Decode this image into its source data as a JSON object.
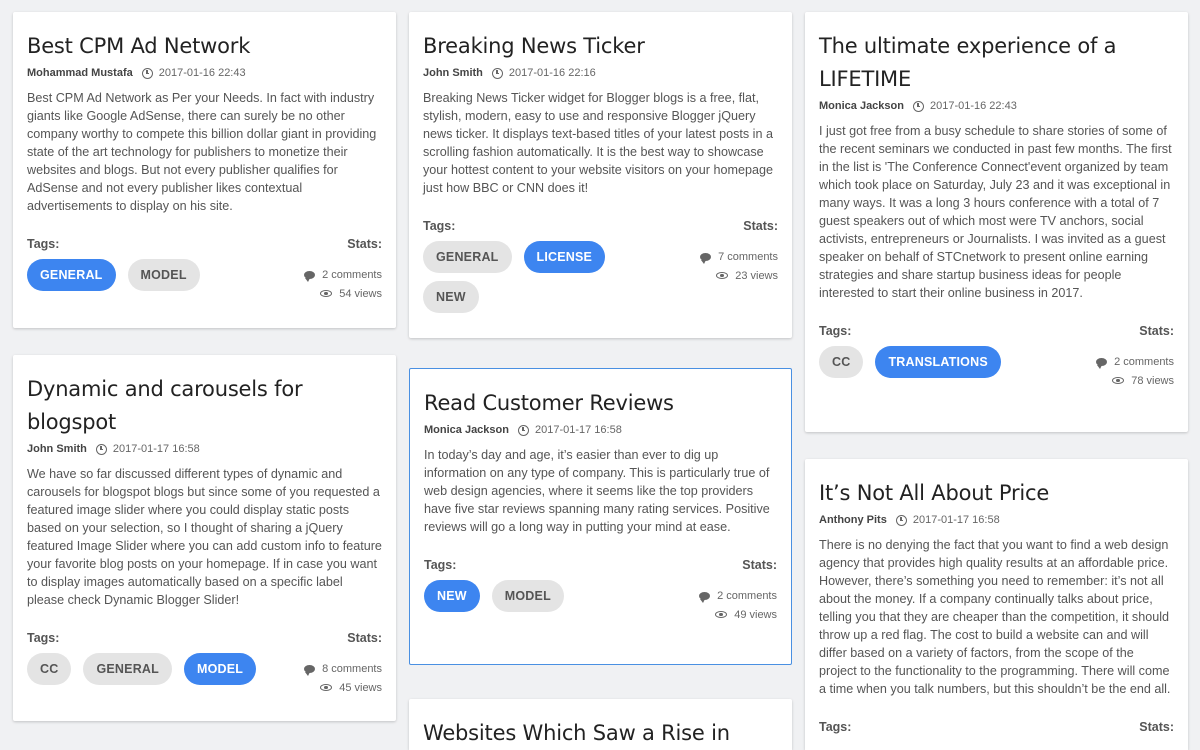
{
  "labels": {
    "tags": "Tags:",
    "stats": "Stats:"
  },
  "colors": {
    "accent": "#3d85f0",
    "page_bg": "#f0f1f3",
    "active_border": "#4a90e2"
  },
  "icons": {
    "clock": "clock-icon",
    "comment": "comment-icon",
    "views": "eye-icon"
  },
  "posts": [
    {
      "title": "Best CPM Ad Network",
      "author": "Mohammad Mustafa",
      "date": "2017-01-16 22:43",
      "excerpt": "Best CPM Ad Network as Per your Needs. In fact with industry giants like Google AdSense, there can surely be no other company worthy to compete this billion dollar giant in providing state of the art technology for publishers to monetize their websites and blogs. But not every publisher qualifies for AdSense and not every publisher likes contextual advertisements to display on his site.",
      "tags": [
        {
          "label": "GENERAL",
          "active": true
        },
        {
          "label": "MODEL",
          "active": false
        }
      ],
      "comments": "2 comments",
      "views": "54 views"
    },
    {
      "title": "Breaking News Ticker",
      "author": "John Smith",
      "date": "2017-01-16 22:16",
      "excerpt": "Breaking News Ticker widget for Blogger blogs is a free, flat, stylish, modern, easy to use and responsive Blogger jQuery news ticker. It displays text-based titles of your latest posts in a scrolling fashion automatically. It is the best way to showcase your hottest content to your website visitors on your homepage just how BBC or CNN does it!",
      "tags": [
        {
          "label": "GENERAL",
          "active": false
        },
        {
          "label": "LICENSE",
          "active": true
        },
        {
          "label": "NEW",
          "active": false
        }
      ],
      "comments": "7 comments",
      "views": "23 views"
    },
    {
      "title": "The ultimate experience of a LIFETIME",
      "author": "Monica Jackson",
      "date": "2017-01-16 22:43",
      "excerpt": "I just got free from a busy schedule to share stories of some of the recent seminars we conducted in past few months. The first in the list is 'The Conference Connect'event organized by team which took place on Saturday, July 23 and it was exceptional in many ways. It was a long 3 hours conference with a total of 7 guest speakers out of which most were TV anchors, social activists, entrepreneurs or Journalists. I was invited as a guest speaker on behalf of STCnetwork to present online earning strategies and share startup business ideas for people interested to start their online business in 2017.",
      "tags": [
        {
          "label": "CC",
          "active": false
        },
        {
          "label": "TRANSLATIONS",
          "active": true
        }
      ],
      "comments": "2 comments",
      "views": "78 views"
    },
    {
      "title": "Dynamic and carousels for blogspot",
      "author": "John Smith",
      "date": "2017-01-17 16:58",
      "excerpt": "We have so far discussed different types of dynamic and carousels for blogspot blogs but since some of you requested a featured image slider where you could display static posts based on your selection, so I thought of sharing a jQuery featured Image Slider where you can add custom info to feature your favorite blog posts on your homepage. If in case you want to display images automatically based on a specific label please check Dynamic Blogger Slider!",
      "tags": [
        {
          "label": "CC",
          "active": false
        },
        {
          "label": "GENERAL",
          "active": false
        },
        {
          "label": "MODEL",
          "active": true
        }
      ],
      "comments": "8 comments",
      "views": "45 views"
    },
    {
      "title": "Read Customer Reviews",
      "author": "Monica Jackson",
      "date": "2017-01-17 16:58",
      "excerpt": "In today’s day and age, it’s easier than ever to dig up information on any type of company. This is particularly true of web design agencies, where it seems like the top providers have five star reviews spanning many rating services. Positive reviews will go a long way in putting your mind at ease.",
      "tags": [
        {
          "label": "NEW",
          "active": true
        },
        {
          "label": "MODEL",
          "active": false
        }
      ],
      "comments": "2 comments",
      "views": "49 views"
    },
    {
      "title": "It’s Not All About Price",
      "author": "Anthony Pits",
      "date": "2017-01-17 16:58",
      "excerpt": "There is no denying the fact that you want to find a web design agency that provides high quality results at an affordable price. However, there’s something you need to remember: it’s not all about the money. If a company continually talks about price, telling you that they are cheaper than the competition, it should throw up a red flag. The cost to build a website can and will differ based on a variety of factors, from the scope of the project to the functionality to the programming. There will come a time when you talk numbers, but this shouldn’t be the end all."
    },
    {
      "title": "Websites Which Saw a Rise in"
    }
  ]
}
